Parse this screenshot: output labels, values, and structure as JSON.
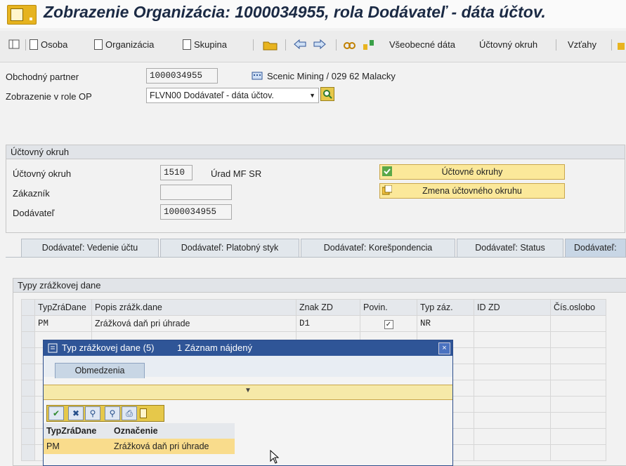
{
  "window": {
    "title": "Zobrazenie Organizácia: 1000034955, rola Dodávateľ - dáta účtov."
  },
  "toolbar": {
    "osoba": "Osoba",
    "organizacia": "Organizácia",
    "skupina": "Skupina",
    "vseobecne": "Všeobecné dáta",
    "uctovny_okruh": "Účtovný okruh",
    "vztahy": "Vzťahy"
  },
  "header": {
    "partner_label": "Obchodný partner",
    "partner_value": "1000034955",
    "partner_desc": "Scenic Mining / 029 62 Malacky",
    "role_label": "Zobrazenie v role OP",
    "role_value": "FLVN00 Dodávateľ - dáta účtov."
  },
  "company_code": {
    "group_title": "Účtovný okruh",
    "uo_label": "Účtovný okruh",
    "uo_value": "1510",
    "uo_desc": "Úrad MF SR",
    "zakaznik_label": "Zákazník",
    "zakaznik_value": "",
    "dodavatel_label": "Dodávateľ",
    "dodavatel_value": "1000034955",
    "btn_okruhy": "Účtovné okruhy",
    "btn_zmena": "Zmena účtovného okruhu"
  },
  "tabs": [
    "Dodávateľ: Vedenie účtu",
    "Dodávateľ: Platobný styk",
    "Dodávateľ: Korešpondencia",
    "Dodávateľ: Status",
    "Dodávateľ:"
  ],
  "wht": {
    "group_title": "Typy zrážkovej dane",
    "columns": [
      "TypZráDane",
      "Popis zrážk.dane",
      "Znak ZD",
      "Povin.",
      "Typ záz.",
      "ID ZD",
      "Čís.oslobo"
    ],
    "rows": [
      {
        "typ": "PM",
        "popis": "Zrážková daň pri úhrade",
        "znak": "D1",
        "povin": "✓",
        "typzaz": "NR",
        "id": "",
        "cis": ""
      }
    ]
  },
  "popup": {
    "title": "Typ zrážkovej dane (5)",
    "found": "1 Záznam nájdený",
    "close": "×",
    "tab": "Obmedzenia",
    "columns": [
      "TypZráDane",
      "Označenie"
    ],
    "row": {
      "typ": "PM",
      "oznacenie": "Zrážková daň pri úhrade"
    }
  },
  "colors": {
    "title": "#1b2a44",
    "popup_header": "#2f5597",
    "button_yellow": "#fbe89a",
    "selected_row": "#f9dc8c"
  }
}
